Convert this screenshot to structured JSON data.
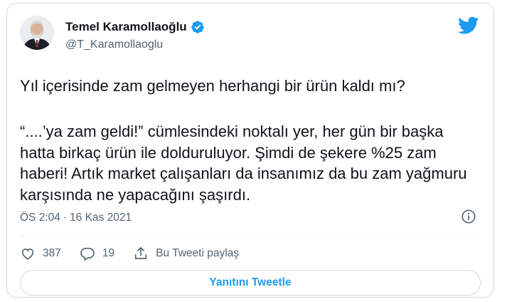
{
  "author": {
    "name": "Temel Karamollaoğlu",
    "handle": "@T_Karamollaoglu"
  },
  "tweet": {
    "line1": "Yıl içerisinde zam gelmeyen herhangi bir ürün kaldı mı?",
    "paragraph2": "“....’ya zam geldi!” cümlesindeki noktalı yer, her gün bir başka hatta birkaç ürün ile dolduruluyor. Şimdi de şekere %25 zam haberi! Artık market çalışanları da insanımız da bu zam yağmuru karşısında ne yapacağını şaşırdı."
  },
  "meta": {
    "time": "ÖS 2:04",
    "separator": "·",
    "date": "16 Kas 2021"
  },
  "actions": {
    "likes": "387",
    "replies": "19",
    "share_label": "Bu Tweeti paylaş"
  },
  "reply_button": "Yanıtını Tweetle",
  "colors": {
    "accent": "#1d9bf0",
    "secondary_text": "#536471",
    "border": "#cfd9de"
  }
}
